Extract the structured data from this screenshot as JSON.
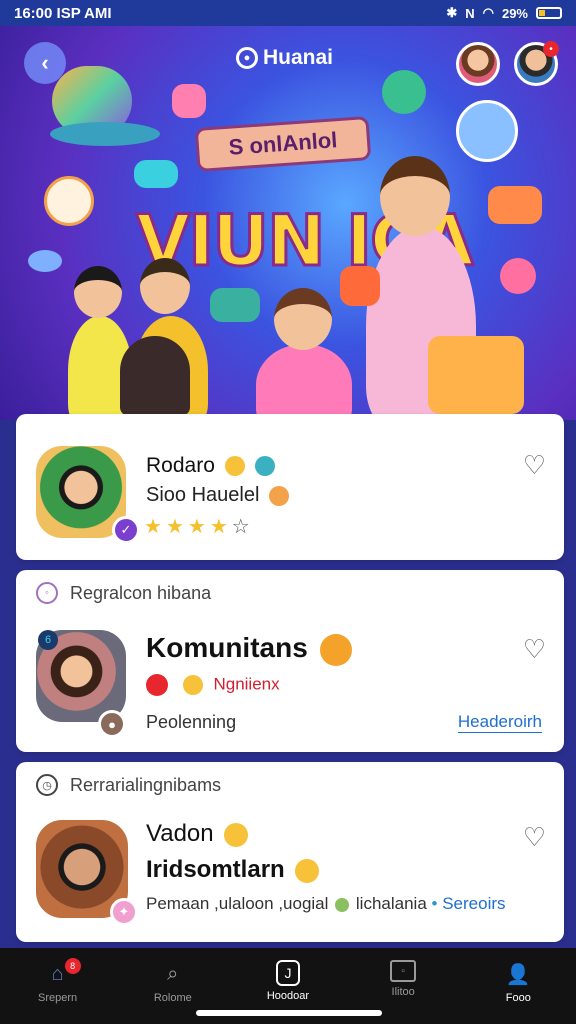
{
  "status_bar": {
    "time": "16:00 ISP AMI",
    "battery": "29%"
  },
  "header": {
    "brand": "Huanai"
  },
  "banner": {
    "ribbon_text": "S onlAnlol",
    "title": "VIUN ICA"
  },
  "cards": [
    {
      "name": "Rodaro",
      "subtitle": "Sioo Hauelel",
      "rating_filled": 4,
      "rating_total": 5
    },
    {
      "section_label": "Regralcon hibana",
      "title": "Komunitans",
      "tag": "Ngniienx",
      "meta": "Peolenning",
      "link": "Headeroirh"
    },
    {
      "section_label": "Rerrarialingnibams",
      "name": "Vadon",
      "name2": "Iridsomtlarn",
      "meta_left": "Pemaan ,ulaloon ,uogial",
      "meta_mid": "lichalania",
      "link": "Sereoirs"
    }
  ],
  "nav": [
    {
      "label": "Srepern",
      "badge": "8"
    },
    {
      "label": "Rolome"
    },
    {
      "label": "Hoodoar"
    },
    {
      "label": "Ilitoo"
    },
    {
      "label": "Fooo"
    }
  ],
  "colors": {
    "accent_purple": "#7b3fd0",
    "link_blue": "#1f6fd0",
    "star": "#f4c12c",
    "notif_red": "#e8262e"
  }
}
